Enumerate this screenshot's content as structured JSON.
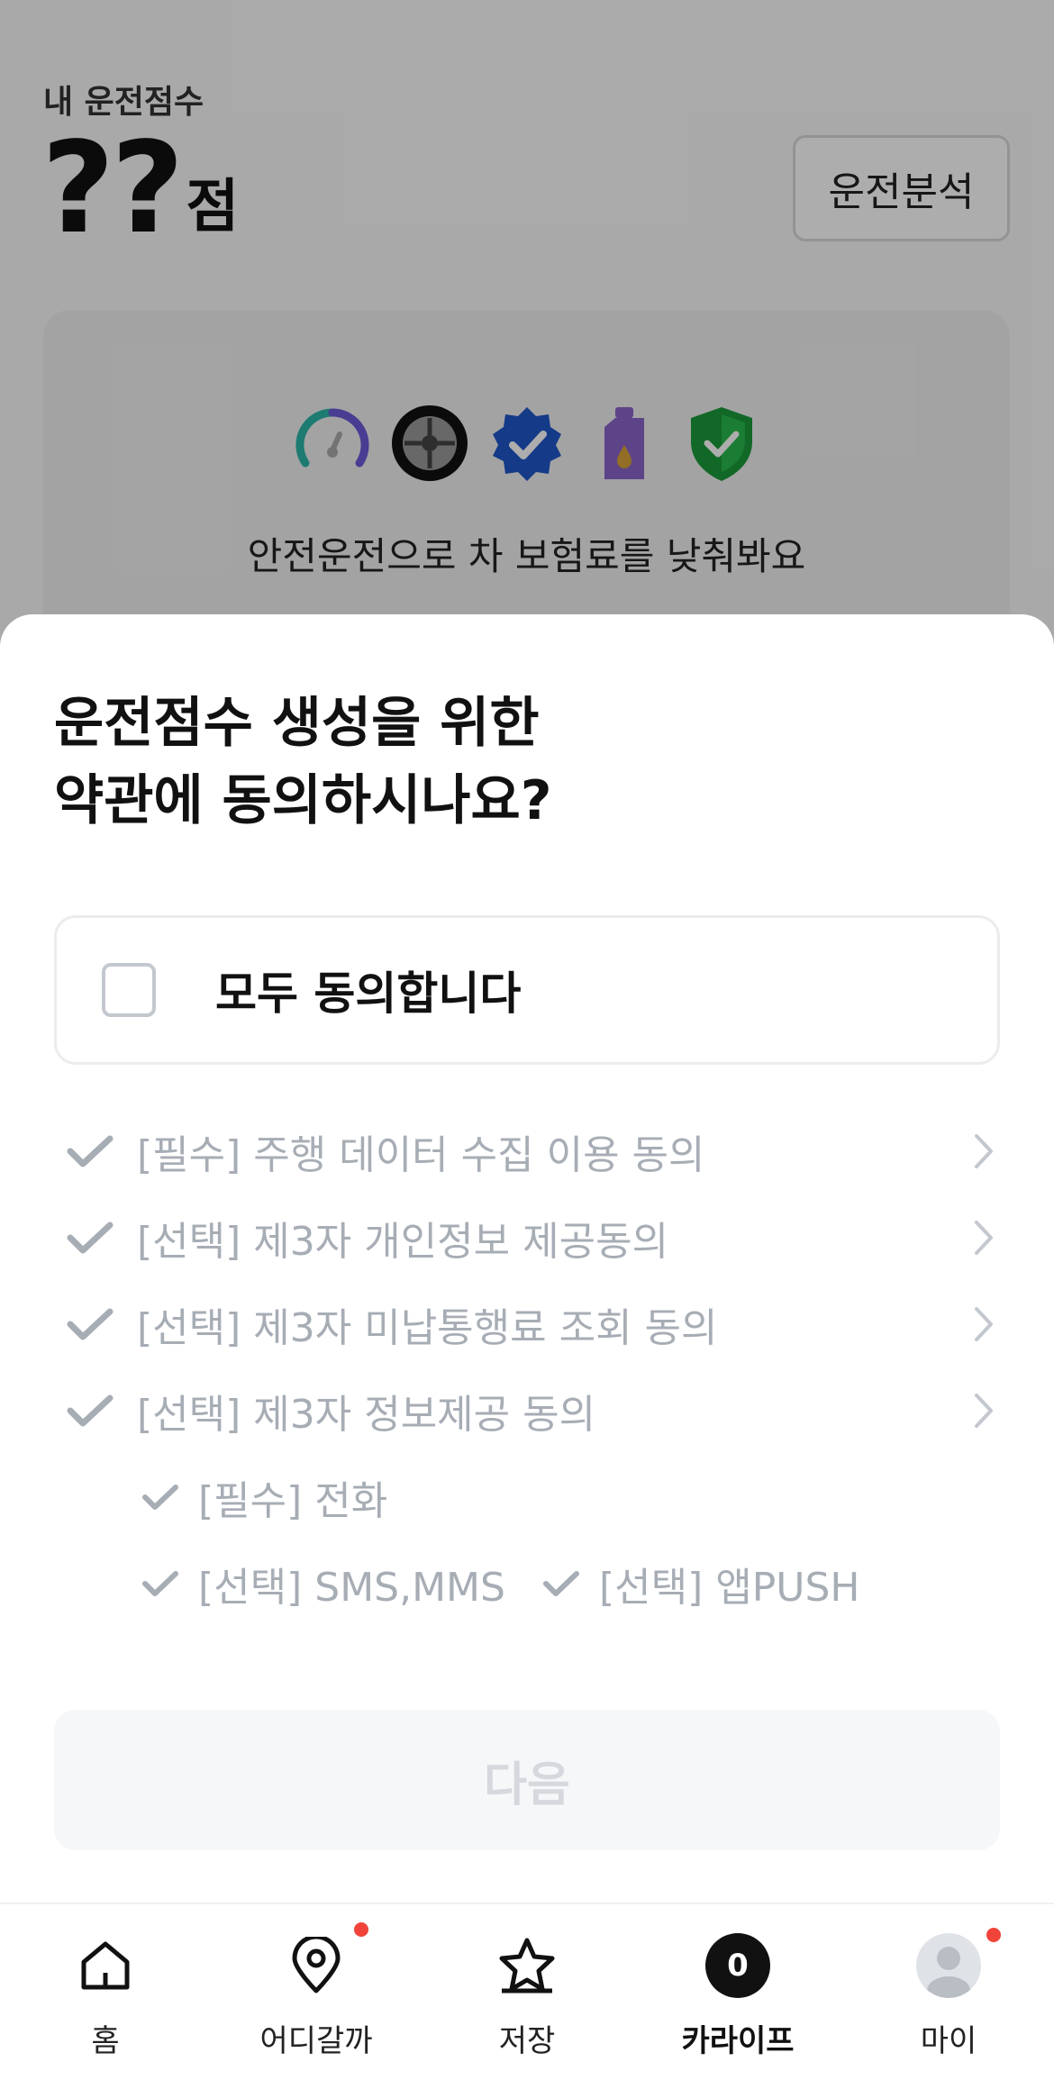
{
  "background": {
    "subtitle": "내 운전점수",
    "score_value": "??",
    "score_unit": "점",
    "analysis_button": "운전분석",
    "promo_text": "안전운전으로 차 보험료를 낮춰봐요",
    "promo_icons": [
      "gauge-icon",
      "tire-icon",
      "verified-badge-icon",
      "oil-bottle-icon",
      "shield-check-icon"
    ]
  },
  "sheet": {
    "title_line1": "운전점수 생성을 위한",
    "title_line2": "약관에 동의하시나요?",
    "agree_all": "모두 동의합니다",
    "terms": [
      {
        "label": "[필수] 주행 데이터 수집 이용 동의"
      },
      {
        "label": "[선택] 제3자 개인정보 제공동의"
      },
      {
        "label": "[선택] 제3자 미납통행료 조회 동의"
      },
      {
        "label": "[선택] 제3자 정보제공 동의"
      }
    ],
    "sub_terms": {
      "phone": "[필수] 전화",
      "sms": "[선택] SMS,MMS",
      "push": "[선택] 앱PUSH"
    },
    "next_button": "다음"
  },
  "tabbar": {
    "items": [
      {
        "label": "홈",
        "icon": "home-icon"
      },
      {
        "label": "어디갈까",
        "icon": "location-pin-icon"
      },
      {
        "label": "저장",
        "icon": "star-icon"
      },
      {
        "label": "카라이프",
        "icon": "count-badge",
        "badge": "0"
      },
      {
        "label": "마이",
        "icon": "avatar-icon"
      }
    ]
  },
  "colors": {
    "check_gray": "#a7adb5",
    "notification_dot": "#f0443a",
    "primary_text": "#111111"
  }
}
